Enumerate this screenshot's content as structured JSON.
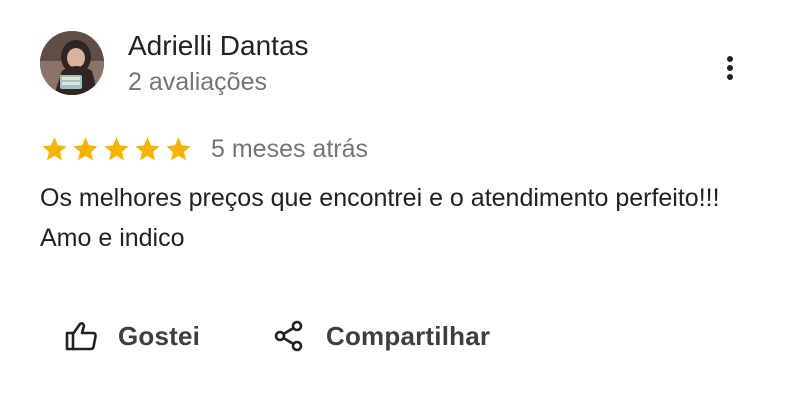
{
  "reviewer": {
    "name": "Adrielli Dantas",
    "meta": "2 avaliações",
    "avatar_icon": "user-photo-avatar"
  },
  "menu": {
    "icon": "more-vertical-icon"
  },
  "rating": {
    "stars": 5,
    "max_stars": 5,
    "star_color": "#f4b400",
    "date": "5 meses atrás"
  },
  "review": {
    "text": "Os melhores preços que encontrei e o atendimento perfeito!!! Amo e indico"
  },
  "actions": {
    "like_label": "Gostei",
    "like_icon": "thumbs-up-icon",
    "share_label": "Compartilhar",
    "share_icon": "share-icon"
  }
}
